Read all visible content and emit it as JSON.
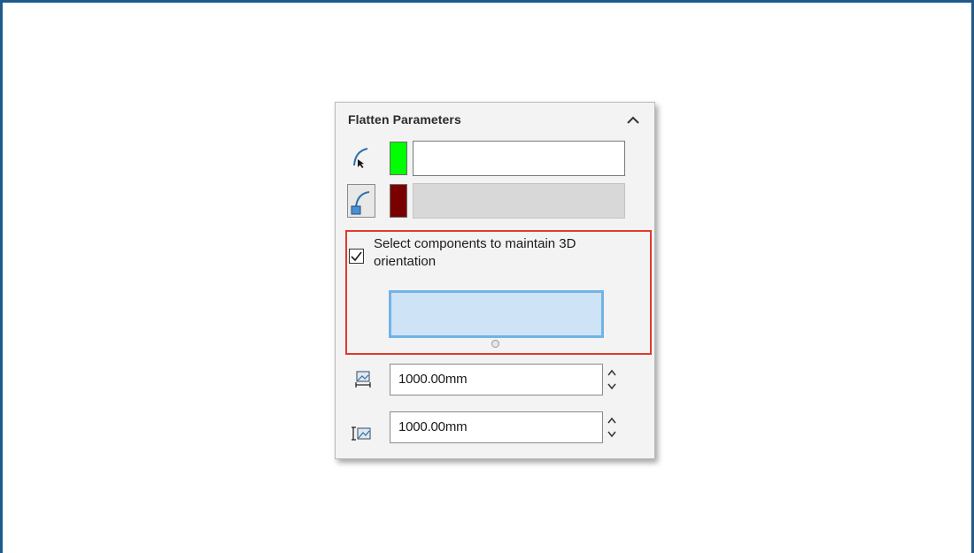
{
  "panel": {
    "title": "Flatten Parameters",
    "collapse_icon": "chevron-up-icon",
    "selection_rows": [
      {
        "icon": "curve-select-icon",
        "color": "#00ff00",
        "state": "active"
      },
      {
        "icon": "curve-fixed-icon",
        "color": "#7a0000",
        "state": "inactive"
      }
    ],
    "maintain_orientation": {
      "checked": true,
      "label_line1": "Select components to maintain 3D",
      "label_line2": "orientation"
    },
    "width_field": {
      "icon": "width-dimension-icon",
      "value": "1000.00mm"
    },
    "height_field": {
      "icon": "height-dimension-icon",
      "value": "1000.00mm"
    }
  },
  "colors": {
    "accent_border": "#1f5a8c",
    "highlight": "#e03a2e",
    "selection_box": "#cfe3f7"
  }
}
